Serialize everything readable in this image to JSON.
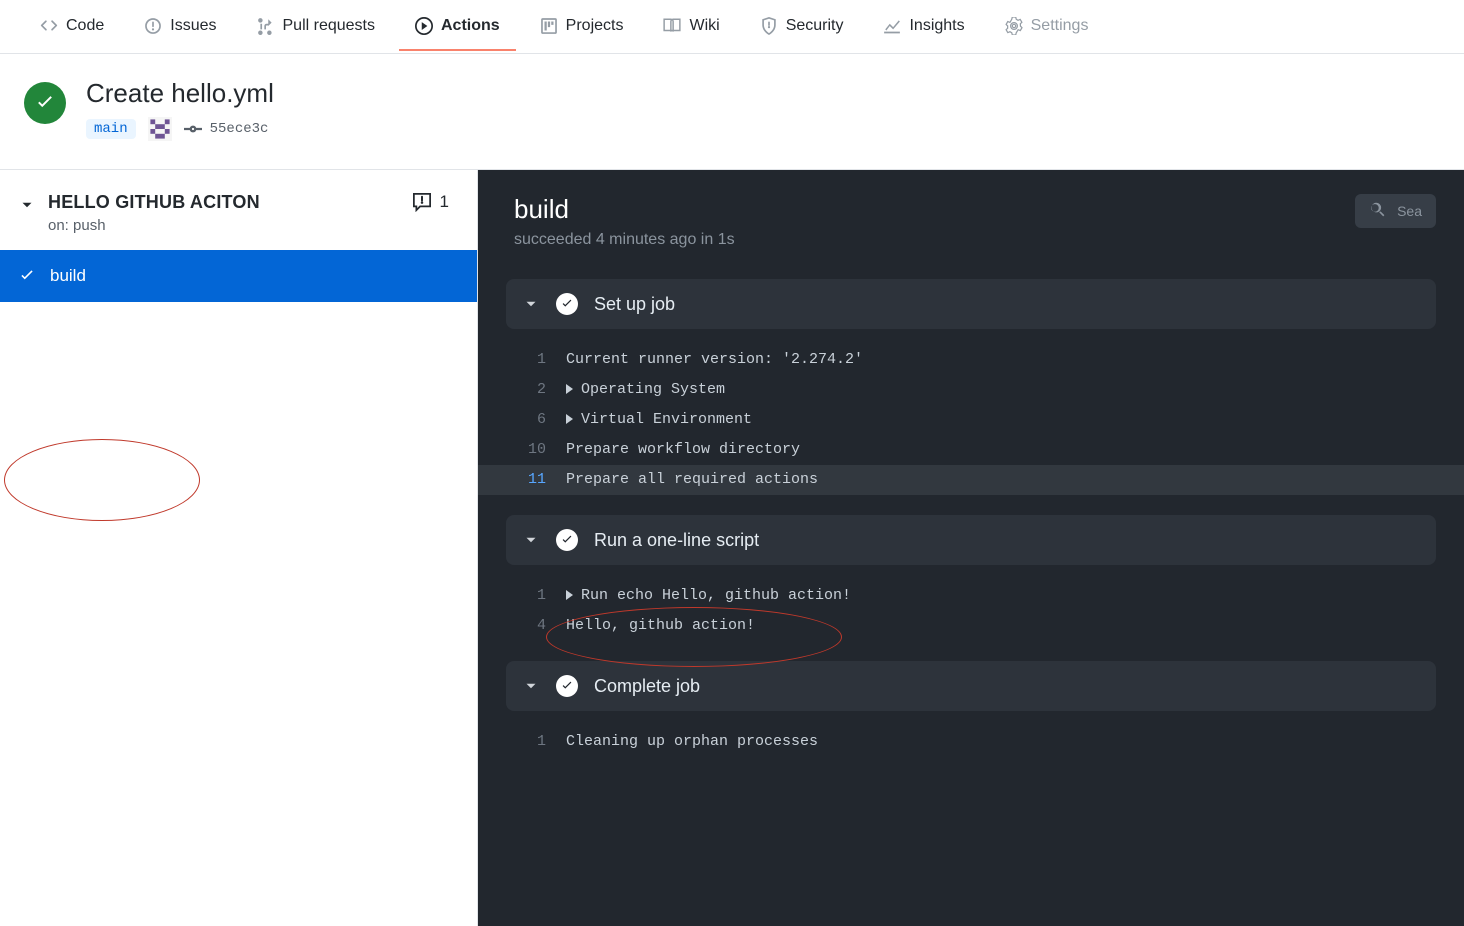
{
  "tabs": [
    {
      "label": "Code",
      "icon": "code"
    },
    {
      "label": "Issues",
      "icon": "issue"
    },
    {
      "label": "Pull requests",
      "icon": "pr"
    },
    {
      "label": "Actions",
      "icon": "play",
      "active": true
    },
    {
      "label": "Projects",
      "icon": "project"
    },
    {
      "label": "Wiki",
      "icon": "book"
    },
    {
      "label": "Security",
      "icon": "shield"
    },
    {
      "label": "Insights",
      "icon": "graph"
    },
    {
      "label": "Settings",
      "icon": "gear",
      "muted": true
    }
  ],
  "run": {
    "title": "Create hello.yml",
    "branch": "main",
    "commit_sha": "55ece3c"
  },
  "workflow": {
    "name": "HELLO GITHUB ACITON",
    "trigger": "on: push",
    "annotation_count": "1"
  },
  "sidebar_job": {
    "label": "build"
  },
  "job": {
    "title": "build",
    "subtitle": "succeeded 4 minutes ago in 1s"
  },
  "search_placeholder": "Sea",
  "steps": {
    "setup": {
      "title": "Set up job",
      "lines": [
        {
          "n": "1",
          "text": "Current runner version: '2.274.2'"
        },
        {
          "n": "2",
          "text": "Operating System",
          "expandable": true
        },
        {
          "n": "6",
          "text": "Virtual Environment",
          "expandable": true
        },
        {
          "n": "10",
          "text": "Prepare workflow directory"
        },
        {
          "n": "11",
          "text": "Prepare all required actions",
          "selected": true
        }
      ]
    },
    "script": {
      "title": "Run a one-line script",
      "lines": [
        {
          "n": "1",
          "text": "Run echo Hello, github action!",
          "expandable": true
        },
        {
          "n": "4",
          "text": "Hello, github action!"
        }
      ]
    },
    "complete": {
      "title": "Complete job",
      "lines": [
        {
          "n": "1",
          "text": "Cleaning up orphan processes"
        }
      ]
    }
  }
}
